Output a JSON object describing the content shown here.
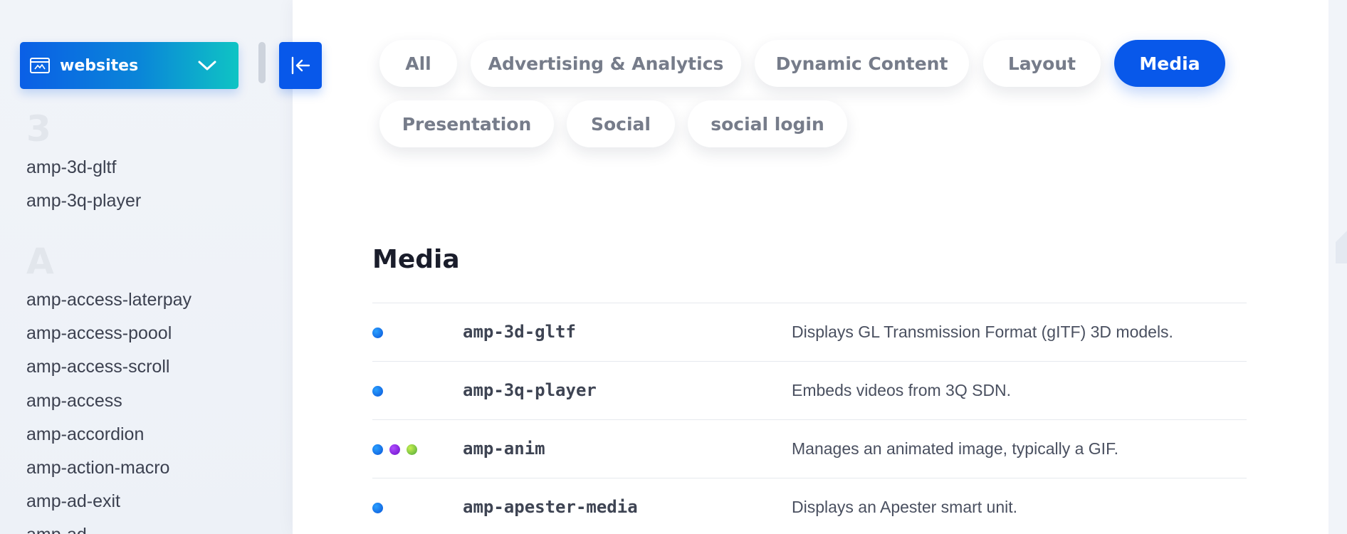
{
  "sidebar": {
    "format_select": {
      "label": "websites",
      "icon": "website-icon"
    },
    "sections": [
      {
        "letter": "3",
        "items": [
          "amp-3d-gltf",
          "amp-3q-player"
        ]
      },
      {
        "letter": "A",
        "items": [
          "amp-access-laterpay",
          "amp-access-poool",
          "amp-access-scroll",
          "amp-access",
          "amp-accordion",
          "amp-action-macro",
          "amp-ad-exit",
          "amp-ad"
        ]
      }
    ]
  },
  "collapse_button": {
    "icon": "collapse-left-icon"
  },
  "filters": {
    "items": [
      "All",
      "Advertising & Analytics",
      "Dynamic Content",
      "Layout",
      "Media",
      "Presentation",
      "Social",
      "social login"
    ],
    "active": "Media"
  },
  "main": {
    "heading": "Media",
    "components": [
      {
        "name": "amp-3d-gltf",
        "description": "Displays GL Transmission Format (gITF) 3D models.",
        "formats": [
          "websites"
        ]
      },
      {
        "name": "amp-3q-player",
        "description": "Embeds videos from 3Q SDN.",
        "formats": [
          "websites"
        ]
      },
      {
        "name": "amp-anim",
        "description": "Manages an animated image, typically a GIF.",
        "formats": [
          "websites",
          "stories",
          "ads"
        ]
      },
      {
        "name": "amp-apester-media",
        "description": "Displays an Apester smart unit.",
        "formats": [
          "websites"
        ]
      }
    ]
  },
  "colors": {
    "accent": "#0858ea",
    "format_websites": "#0a6fe0",
    "format_stories": "#8a1fe0",
    "format_ads": "#7cc640"
  }
}
